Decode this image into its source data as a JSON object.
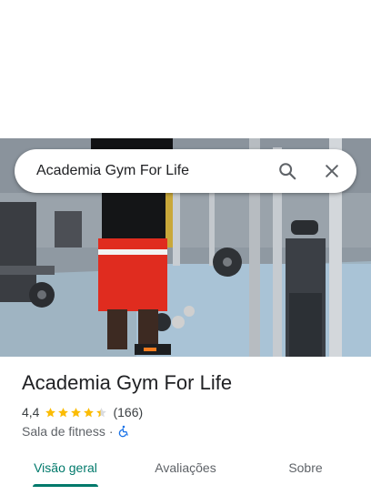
{
  "search": {
    "query": "Academia Gym For Life",
    "search_icon": "search-icon",
    "close_icon": "close-icon"
  },
  "photo": {
    "description_icon": "place-photo"
  },
  "place": {
    "name": "Academia Gym For Life",
    "rating": "4,4",
    "rating_value": 4.4,
    "reviews_count": "(166)",
    "category": "Sala de fitness",
    "separator": "·",
    "accessibility_icon": "wheelchair-icon"
  },
  "tabs": [
    {
      "label": "Visão geral",
      "active": true
    },
    {
      "label": "Avaliações",
      "active": false
    },
    {
      "label": "Sobre",
      "active": false
    }
  ],
  "colors": {
    "accent": "#00796b",
    "star": "#fbbc04",
    "accessibility": "#1a73e8"
  }
}
